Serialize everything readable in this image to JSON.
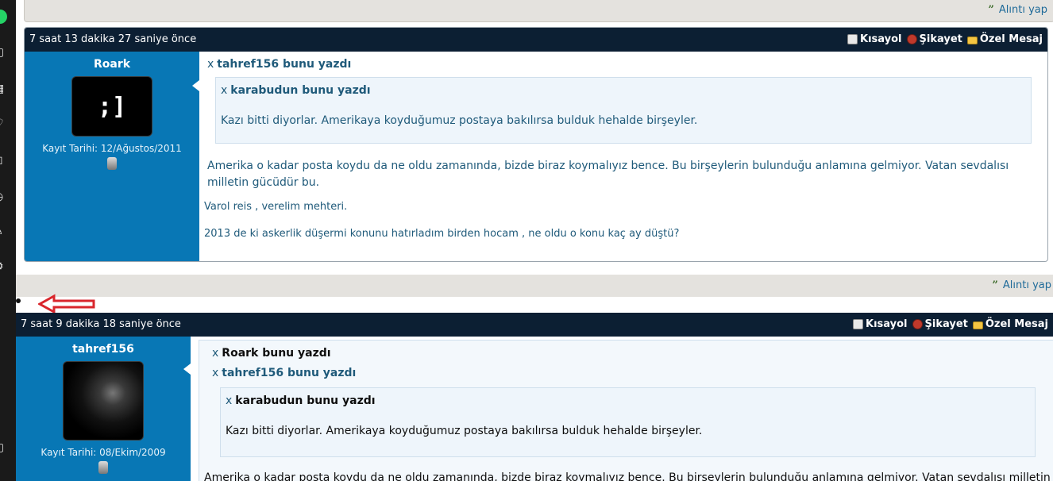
{
  "rail": {
    "icons": [
      "whatsapp-icon",
      "camera-icon",
      "apps-icon",
      "heart-icon",
      "cube-icon",
      "clock-icon",
      "pen-icon",
      "settings-icon",
      "square-icon"
    ]
  },
  "quote_label": "Alıntı yap",
  "actions": {
    "shortcut": "Kısayol",
    "report": "Şikayet",
    "pm": "Özel Mesaj"
  },
  "posts": [
    {
      "time": "7 saat 13 dakika 27 saniye önce",
      "user": {
        "name": "Roark",
        "avatar_text": ";]",
        "registered": "Kayıt Tarihi: 12/Ağustos/2011"
      },
      "quote": {
        "author_line": "tahref156 bunu yazdı",
        "inner": {
          "author_line": "karabudun bunu yazdı",
          "text": "Kazı bitti diyorlar. Amerikaya koyduğumuz postaya bakılırsa bulduk hehalde birşeyler."
        },
        "text": "Amerika o kadar posta koydu da ne oldu zamanında, bizde biraz koymalıyız bence. Bu birşeylerin bulunduğu anlamına gelmiyor. Vatan sevdalısı milletin gücüdür bu."
      },
      "lines": [
        "Varol reis , verelim mehteri.",
        "2013 de ki askerlik düşermi konunu hatırladım birden hocam , ne oldu o konu kaç ay düştü?"
      ]
    },
    {
      "time": "7 saat 9 dakika 18 saniye önce",
      "user": {
        "name": "tahref156",
        "registered": "Kayıt Tarihi: 08/Ekim/2009"
      },
      "quote": {
        "author_line": "Roark bunu yazdı",
        "second_author_line": "tahref156 bunu yazdı",
        "inner": {
          "author_line": "karabudun bunu yazdı",
          "text": "Kazı bitti diyorlar. Amerikaya koyduğumuz postaya bakılırsa bulduk hehalde birşeyler."
        },
        "text": "Amerika o kadar posta koydu da ne oldu zamanında, bizde biraz koymalıyız bence. Bu birşeylerin bulunduğu anlamına gelmiyor. Vatan sevdalısı milletin"
      }
    }
  ],
  "x_mark": "x",
  "colors": {
    "header": "#0c1f33",
    "userpane": "#0877b5",
    "link": "#1f5a7a",
    "arrow": "#d9262c"
  }
}
